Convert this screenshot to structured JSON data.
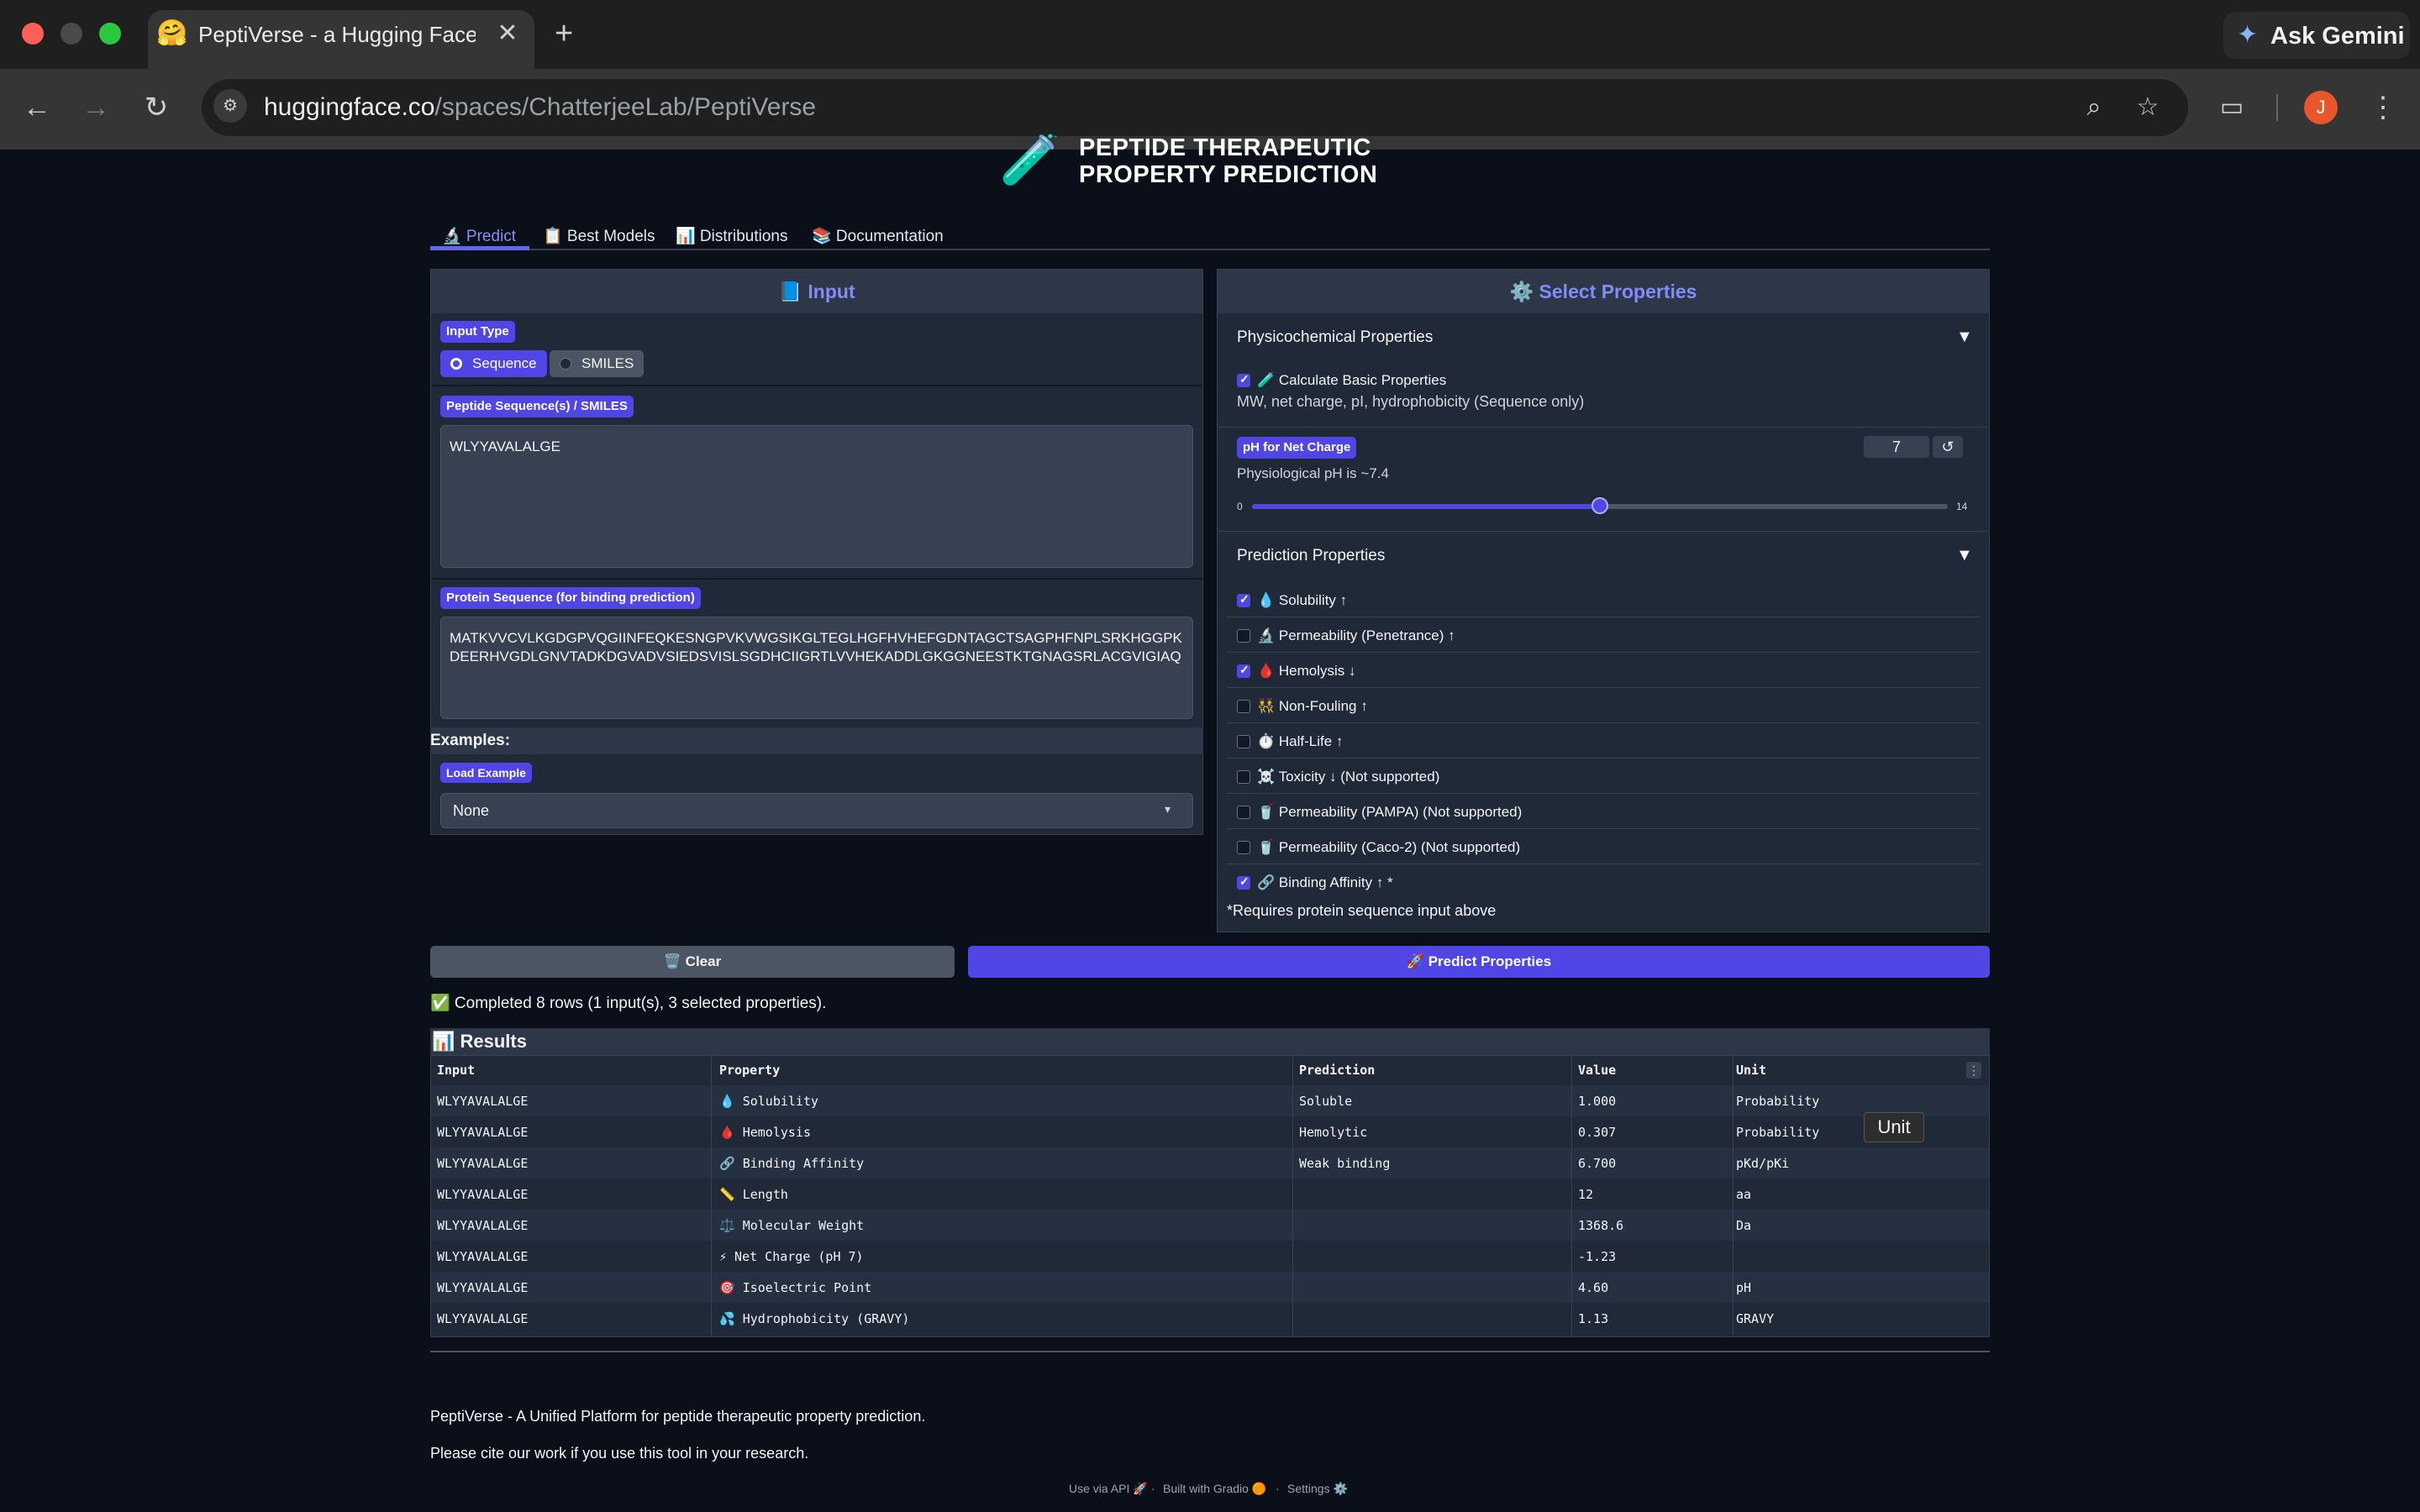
{
  "browser": {
    "tab_title": "PeptiVerse - a Hugging Face Space by ChatterjeeLab",
    "tab_favicon": "🤗",
    "new_tab_icon": "+",
    "gemini_label": "Ask Gemini",
    "url_host": "huggingface.co",
    "url_path": "/spaces/ChatterjeeLab/PeptiVerse",
    "avatar_letter": "J",
    "traffic_colors": [
      "#ff5f57",
      "#febc2e",
      "#28c840"
    ]
  },
  "header": {
    "title_line1": "PEPTIDE THERAPEUTIC",
    "title_line2": "PROPERTY PREDICTION"
  },
  "tabs": [
    {
      "label": "🔬 Predict",
      "active": true
    },
    {
      "label": "📋 Best Models",
      "active": false
    },
    {
      "label": "📊 Distributions",
      "active": false
    },
    {
      "label": "📚 Documentation",
      "active": false
    }
  ],
  "input_panel": {
    "header": "📘 Input",
    "input_type_label": "Input Type",
    "input_type_options": [
      "Sequence",
      "SMILES"
    ],
    "input_type_selected": "Sequence",
    "peptide_label": "Peptide Sequence(s) / SMILES",
    "peptide_value": "WLYYAVALALGE",
    "protein_label": "Protein Sequence (for binding prediction)",
    "protein_value": "MATKVVCVLKGDGPVQGIINFEQKESNGPVKVWGSIKGLTEGLHGFHVHEFGDNTAGCTSAGPHFNPLSRKHGGPKDEERHVGDLGNVTADKDGVADVSIEDSVISLSGDHCIIGRTLVVHEKADDLGKGGNEESTKTGNAGSRLACGVIGIAQ",
    "examples_label": "Examples:",
    "load_example_label": "Load Example",
    "load_example_value": "None"
  },
  "properties_panel": {
    "header": "⚙️ Select Properties",
    "physchem_title": "Physicochemical Properties",
    "basic_props_label": "🧪 Calculate Basic Properties",
    "basic_props_checked": true,
    "basic_props_info": "MW, net charge, pI, hydrophobicity (Sequence only)",
    "ph_label": "pH for Net Charge",
    "ph_info": "Physiological pH is ~7.4",
    "ph_value": "7",
    "ph_min": "0",
    "ph_max": "14",
    "ph_fraction": 0.5,
    "reset_icon": "↺",
    "prediction_title": "Prediction Properties",
    "collapse_icon": "▼",
    "items": [
      {
        "label": "💧 Solubility ↑",
        "checked": true
      },
      {
        "label": "🔬 Permeability (Penetrance) ↑",
        "checked": false
      },
      {
        "label": "🩸 Hemolysis ↓",
        "checked": true
      },
      {
        "label": "👯 Non-Fouling ↑",
        "checked": false
      },
      {
        "label": "⏱️ Half-Life ↑",
        "checked": false
      },
      {
        "label": "☠️ Toxicity ↓ (Not supported)",
        "checked": false
      },
      {
        "label": "🥤 Permeability (PAMPA) (Not supported)",
        "checked": false
      },
      {
        "label": "🥤 Permeability (Caco-2) (Not supported)",
        "checked": false
      },
      {
        "label": "🔗 Binding Affinity ↑ *",
        "checked": true
      }
    ],
    "footnote": "*Requires protein sequence input above"
  },
  "actions": {
    "clear_label": "🗑️ Clear",
    "predict_label": "🚀 Predict Properties"
  },
  "status": "✅ Completed 8 rows (1 input(s), 3 selected properties).",
  "results": {
    "title": "📊 Results",
    "columns": [
      "Input",
      "Property",
      "Prediction",
      "Value",
      "Unit"
    ],
    "column_menu_icon": "⋮",
    "tooltip": "Unit",
    "rows": [
      [
        "WLYYAVALALGE",
        "💧 Solubility",
        "Soluble",
        "1.000",
        "Probability"
      ],
      [
        "WLYYAVALALGE",
        "🩸 Hemolysis",
        "Hemolytic",
        "0.307",
        "Probability"
      ],
      [
        "WLYYAVALALGE",
        "🔗 Binding Affinity",
        "Weak binding",
        "6.700",
        "pKd/pKi"
      ],
      [
        "WLYYAVALALGE",
        "📏 Length",
        "",
        "12",
        "aa"
      ],
      [
        "WLYYAVALALGE",
        "⚖️ Molecular Weight",
        "",
        "1368.6",
        "Da"
      ],
      [
        "WLYYAVALALGE",
        "⚡ Net Charge (pH 7)",
        "",
        "-1.23",
        ""
      ],
      [
        "WLYYAVALALGE",
        "🎯 Isoelectric Point",
        "",
        "4.60",
        "pH"
      ],
      [
        "WLYYAVALALGE",
        "💦 Hydrophobicity (GRAVY)",
        "",
        "1.13",
        "GRAVY"
      ]
    ]
  },
  "footer": {
    "line1": "PeptiVerse - A Unified Platform for peptide therapeutic property prediction.",
    "line2": "Please cite our work if you use this tool in your research.",
    "api_link": "Use via API 🚀",
    "built_link": "Built with Gradio 🟠",
    "settings_link": "Settings ⚙️",
    "separator": "·"
  },
  "colors": {
    "accent": "#4f46e5",
    "panel": "#1f2937",
    "page_bg": "#0b0f19"
  }
}
